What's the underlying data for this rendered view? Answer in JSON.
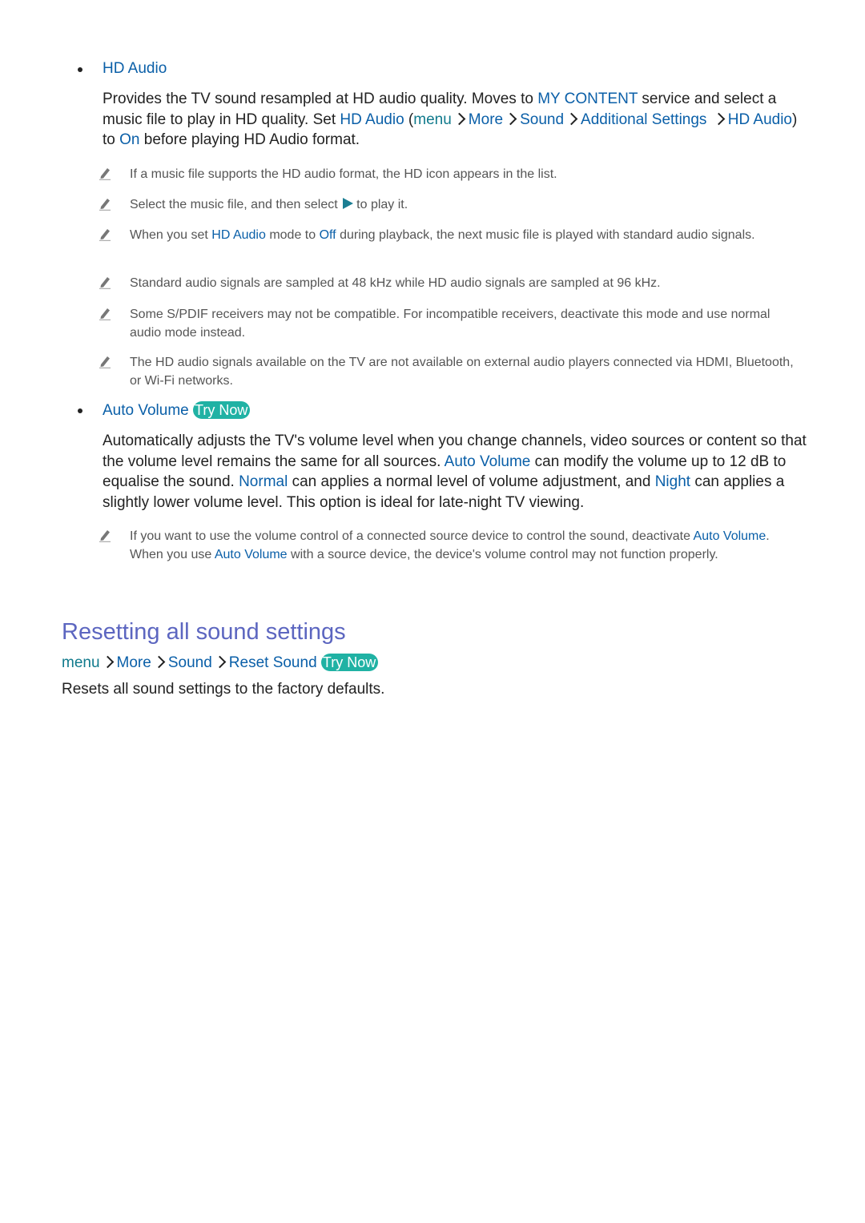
{
  "hd_audio": {
    "title": "HD Audio",
    "para": {
      "t1": "Provides the TV sound resampled at HD audio quality. Moves to ",
      "my_content": "MY CONTENT",
      "t2": " service and select a music file to play in HD quality. Set ",
      "hd_audio": "HD Audio",
      "t3": " (",
      "menu": "menu",
      "more": "More",
      "sound": "Sound",
      "additional": "Additional Settings",
      "hd_audio2": "HD Audio",
      "t4": ") to ",
      "on": "On",
      "t5": " before playing HD Audio format."
    },
    "notes": {
      "n1": "If a music file supports the HD audio format, the HD icon appears in the list.",
      "n2a": "Select the music file, and then select",
      "n2b": "to play it.",
      "n3a": "When you set ",
      "n3_hd": "HD Audio",
      "n3b": " mode to ",
      "n3_off": "Off",
      "n3c": " during playback, the next music file is played with standard audio signals.",
      "n4": "Standard audio signals are sampled at 48 kHz while HD audio signals are sampled at 96 kHz.",
      "n5": "Some S/PDIF receivers may not be compatible. For incompatible receivers, deactivate this mode and use normal audio mode instead.",
      "n6": "The HD audio signals available on the TV are not available on external audio players connected via HDMI, Bluetooth, or Wi-Fi networks."
    }
  },
  "auto_volume": {
    "title": "Auto Volume",
    "try_now": "Try Now",
    "para": {
      "t1": "Automatically adjusts the TV's volume level when you change channels, video sources or content so that the volume level remains the same for all sources. ",
      "av": "Auto Volume",
      "t2": " can modify the volume up to 12 dB to equalise the sound. ",
      "normal": "Normal",
      "t3": " can applies a normal level of volume adjustment, and ",
      "night": "Night",
      "t4": " can applies a slightly lower volume level. This option is ideal for late-night TV viewing."
    },
    "note": {
      "a": "If you want to use the volume control of a connected source device to control the sound, deactivate ",
      "av1": "Auto Volume",
      "b": ". When you use ",
      "av2": "Auto Volume",
      "c": " with a source device, the device's volume control may not function properly."
    }
  },
  "reset": {
    "title": "Resetting all sound settings",
    "path": {
      "menu": "menu",
      "more": "More",
      "sound": "Sound",
      "reset_sound": "Reset Sound",
      "try_now": "Try Now"
    },
    "desc": "Resets all sound settings to the factory defaults."
  },
  "colors": {
    "link": "#0a5fa8",
    "menu": "#107a8c",
    "heading": "#5c66c0",
    "try_now_bg": "#20b2a4"
  }
}
